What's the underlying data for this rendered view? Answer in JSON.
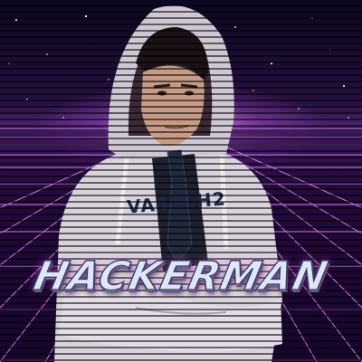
{
  "meme": {
    "title": "HACKERMAN",
    "hoodie_text": "VA4LT.H2"
  },
  "colors": {
    "sky": "#26103f",
    "horizon_glow": "#f096ff",
    "grid_line": "#e48cff",
    "title_fill": "#dfe6f5"
  }
}
